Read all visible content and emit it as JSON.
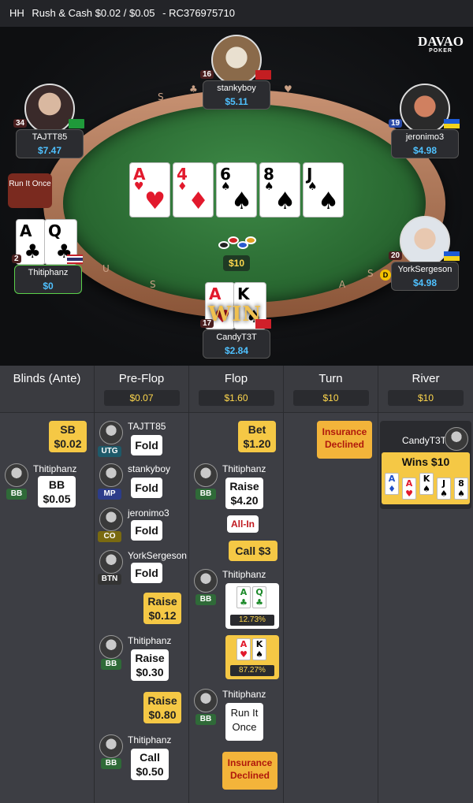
{
  "header": {
    "game_type": "HH",
    "title": "Rush & Cash $0.02 / $0.05",
    "hand_id": "- RC376975710"
  },
  "logo": {
    "top": "DAVAO",
    "bottom": "POKER"
  },
  "table": {
    "run_it_once": "Run It Once",
    "pot": "$10",
    "win_text": "WIN",
    "dealer_button": "D",
    "board": [
      {
        "rank": "A",
        "suit": "♥",
        "color": "red"
      },
      {
        "rank": "4",
        "suit": "♦",
        "color": "red"
      },
      {
        "rank": "6",
        "suit": "♠",
        "color": "black"
      },
      {
        "rank": "8",
        "suit": "♠",
        "color": "black"
      },
      {
        "rank": "J",
        "suit": "♠",
        "color": "black"
      }
    ],
    "seats": {
      "stankyboy": {
        "name": "stankyboy",
        "stack": "$5.11",
        "level": "16"
      },
      "tajtt85": {
        "name": "TAJTT85",
        "stack": "$7.47",
        "level": "34"
      },
      "jeronimo3": {
        "name": "jeronimo3",
        "stack": "$4.98",
        "level": "19"
      },
      "thitiphanz": {
        "name": "Thitiphanz",
        "stack": "$0",
        "level": "2",
        "cards": [
          {
            "rank": "A",
            "suit": "♣"
          },
          {
            "rank": "Q",
            "suit": "♣"
          }
        ]
      },
      "yorksergeson": {
        "name": "YorkSergeson",
        "stack": "$4.98",
        "level": "20"
      },
      "candyt3t": {
        "name": "CandyT3T",
        "stack": "$2.84",
        "level": "17",
        "cards": [
          {
            "rank": "A",
            "suit": "♥"
          },
          {
            "rank": "K",
            "suit": "♠"
          }
        ]
      }
    }
  },
  "history": {
    "columns": [
      {
        "title": "Blinds (Ante)",
        "amount": ""
      },
      {
        "title": "Pre-Flop",
        "amount": "$0.07"
      },
      {
        "title": "Flop",
        "amount": "$1.60"
      },
      {
        "title": "Turn",
        "amount": "$10"
      },
      {
        "title": "River",
        "amount": "$10"
      }
    ],
    "blinds": {
      "sb": {
        "label": "SB",
        "amount": "$0.02"
      },
      "bb": {
        "player": "Thitiphanz",
        "pos": "BB",
        "label": "BB",
        "amount": "$0.05"
      }
    },
    "preflop": [
      {
        "player": "TAJTT85",
        "pos": "UTG",
        "action": "Fold"
      },
      {
        "player": "stankyboy",
        "pos": "MP",
        "action": "Fold"
      },
      {
        "player": "jeronimo3",
        "pos": "CO",
        "action": "Fold"
      },
      {
        "player": "YorkSergeson",
        "pos": "BTN",
        "action": "Fold"
      },
      {
        "raise1": "Raise",
        "raise1_amt": "$0.12"
      },
      {
        "player": "Thitiphanz",
        "pos": "BB",
        "action": "Raise",
        "amount": "$0.30"
      },
      {
        "raise2": "Raise",
        "raise2_amt": "$0.80"
      },
      {
        "player": "Thitiphanz",
        "pos": "BB",
        "action": "Call",
        "amount": "$0.50"
      }
    ],
    "flop": {
      "bet": "Bet",
      "bet_amt": "$1.20",
      "p1_name": "Thitiphanz",
      "p1_pos": "BB",
      "raise": "Raise",
      "raise_amt": "$4.20",
      "allin": "All-In",
      "call": "Call  $3",
      "p2_name": "Thitiphanz",
      "p2_pos": "BB",
      "eq1": "12.73%",
      "eq2": "87.27%",
      "p3_name": "Thitiphanz",
      "p3_pos": "BB",
      "run_it_once": "Run It Once",
      "insurance": "Insurance Declined"
    },
    "turn": {
      "insurance": "Insurance Declined"
    },
    "river": {
      "winner": "CandyT3T",
      "wins": "Wins $10",
      "cards": [
        {
          "rank": "A",
          "suit": "♦",
          "color": "blu"
        },
        {
          "rank": "A",
          "suit": "♥",
          "color": "red"
        },
        {
          "rank": "K",
          "suit": "♠",
          "color": "black"
        },
        {
          "rank": "J",
          "suit": "♠",
          "color": "black"
        },
        {
          "rank": "8",
          "suit": "♠",
          "color": "black"
        }
      ]
    }
  }
}
